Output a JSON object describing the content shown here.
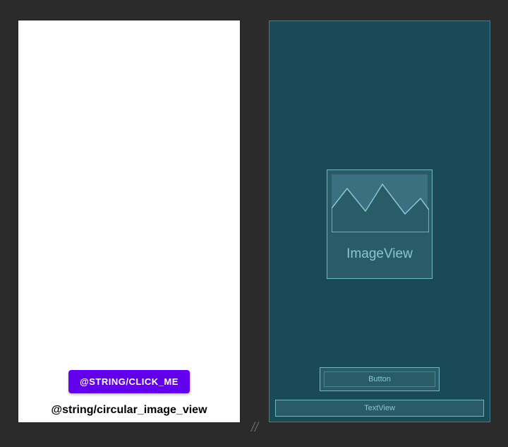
{
  "design": {
    "button_label": "@STRING/CLICK_ME",
    "textview_label": "@string/circular_image_view"
  },
  "blueprint": {
    "imageview_label": "ImageView",
    "button_label": "Button",
    "textview_label": "TextView"
  },
  "colors": {
    "button_bg": "#6200ee",
    "blueprint_bg": "#1a4a55",
    "blueprint_outline": "#6fb7c4",
    "blueprint_text": "#88c6d2"
  }
}
